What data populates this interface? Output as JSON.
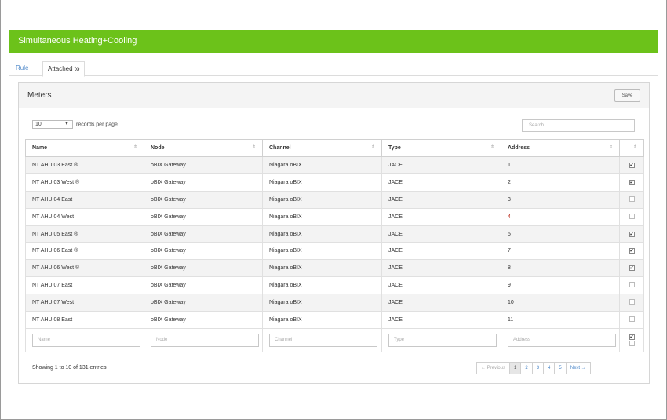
{
  "window": {
    "title": "Simultaneous Heating+Cooling"
  },
  "tabs": [
    {
      "label": "Rule",
      "active": false
    },
    {
      "label": "Attached to",
      "active": true
    }
  ],
  "panel": {
    "title": "Meters",
    "save_label": "Save"
  },
  "length": {
    "value": "10",
    "suffix": "records per page"
  },
  "search": {
    "placeholder": "Search"
  },
  "columns": [
    "Name",
    "Node",
    "Channel",
    "Type",
    "Address",
    ""
  ],
  "rows": [
    {
      "name": "NT AHU 03 East ®",
      "node": "oBIX Gateway",
      "channel": "Niagara oBIX",
      "type": "JACE",
      "address": "1",
      "checked": true
    },
    {
      "name": "NT AHU 03 West ®",
      "node": "oBIX Gateway",
      "channel": "Niagara oBIX",
      "type": "JACE",
      "address": "2",
      "checked": true
    },
    {
      "name": "NT AHU 04 East",
      "node": "oBIX Gateway",
      "channel": "Niagara oBIX",
      "type": "JACE",
      "address": "3",
      "checked": false
    },
    {
      "name": "NT AHU 04 West",
      "node": "oBIX Gateway",
      "channel": "Niagara oBIX",
      "type": "JACE",
      "address": "4",
      "checked": false
    },
    {
      "name": "NT AHU 05 East ®",
      "node": "oBIX Gateway",
      "channel": "Niagara oBIX",
      "type": "JACE",
      "address": "5",
      "checked": true
    },
    {
      "name": "NT AHU 06 East ®",
      "node": "oBIX Gateway",
      "channel": "Niagara oBIX",
      "type": "JACE",
      "address": "7",
      "checked": true
    },
    {
      "name": "NT AHU 06 West ®",
      "node": "oBIX Gateway",
      "channel": "Niagara oBIX",
      "type": "JACE",
      "address": "8",
      "checked": true
    },
    {
      "name": "NT AHU 07 East",
      "node": "oBIX Gateway",
      "channel": "Niagara oBIX",
      "type": "JACE",
      "address": "9",
      "checked": false
    },
    {
      "name": "NT AHU 07 West",
      "node": "oBIX Gateway",
      "channel": "Niagara oBIX",
      "type": "JACE",
      "address": "10",
      "checked": false
    },
    {
      "name": "NT AHU 08 East",
      "node": "oBIX Gateway",
      "channel": "Niagara oBIX",
      "type": "JACE",
      "address": "11",
      "checked": false
    }
  ],
  "filters": {
    "name": "Name",
    "node": "Node",
    "channel": "Channel",
    "type": "Type",
    "address": "Address"
  },
  "info": "Showing 1 to 10 of 131 entries",
  "pagination": {
    "previous": "← Previous",
    "pages": [
      "1",
      "2",
      "3",
      "4",
      "5"
    ],
    "active_page": "1",
    "next": "Next →"
  },
  "colors": {
    "title_bar": "#6cc21a",
    "link": "#4a86c8",
    "address_highlight": "#c0392b"
  }
}
